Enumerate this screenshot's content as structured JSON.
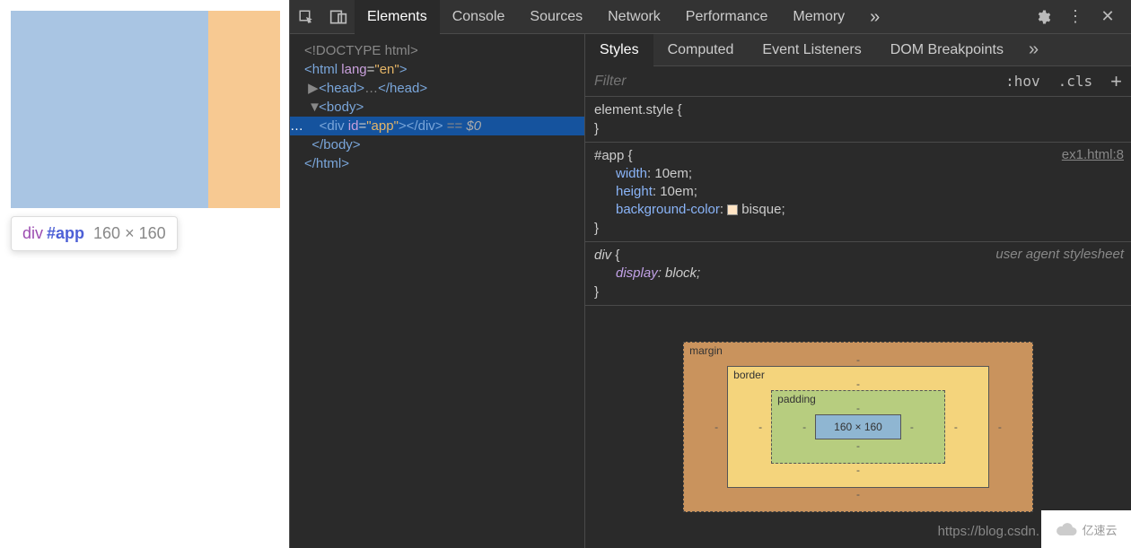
{
  "tooltip": {
    "tag": "div",
    "selector": "#app",
    "dimensions": "160 × 160"
  },
  "toolbar": {
    "tabs": [
      "Elements",
      "Console",
      "Sources",
      "Network",
      "Performance",
      "Memory"
    ],
    "active_tab": 0,
    "more": "»"
  },
  "dom": {
    "l0": "<!DOCTYPE html>",
    "l1_open": "<html ",
    "l1_attr": "lang",
    "l1_eq": "=",
    "l1_val": "\"en\"",
    "l1_close": ">",
    "l2_head_open": "<head>",
    "l2_head_ell": "…",
    "l2_head_close": "</head>",
    "l3_body": "<body>",
    "l4_sel_open": "<div ",
    "l4_attr": "id",
    "l4_eq": "=",
    "l4_val": "\"app\"",
    "l4_close": "></div>",
    "l4_eqdollar": " == ",
    "l4_dollar": "$0",
    "l4_ell": "…",
    "l5_body_close": "</body>",
    "l6_html_close": "</html>"
  },
  "styles_tabs": {
    "items": [
      "Styles",
      "Computed",
      "Event Listeners",
      "DOM Breakpoints"
    ],
    "active": 0,
    "more": "»"
  },
  "filter": {
    "placeholder": "Filter",
    "hov": ":hov",
    "cls": ".cls",
    "plus": "+"
  },
  "rules": {
    "r0": {
      "selector": "element.style",
      "open": " {",
      "close": "}"
    },
    "r1": {
      "selector": "#app",
      "open": " {",
      "link": "ex1.html:8",
      "d1_p": "width",
      "d1_v": ": 10em;",
      "d2_p": "height",
      "d2_v": ": 10em;",
      "d3_p": "background-color",
      "d3_v": "bisque;",
      "close": "}"
    },
    "r2": {
      "selector": "div",
      "open": " {",
      "note": "user agent stylesheet",
      "d1_p": "display",
      "d1_v": ": block;",
      "close": "}"
    }
  },
  "box_model": {
    "margin_label": "margin",
    "border_label": "border",
    "padding_label": "padding",
    "dash": "-",
    "content": "160 × 160"
  },
  "watermark": "https://blog.csdn.",
  "logo": "亿速云"
}
